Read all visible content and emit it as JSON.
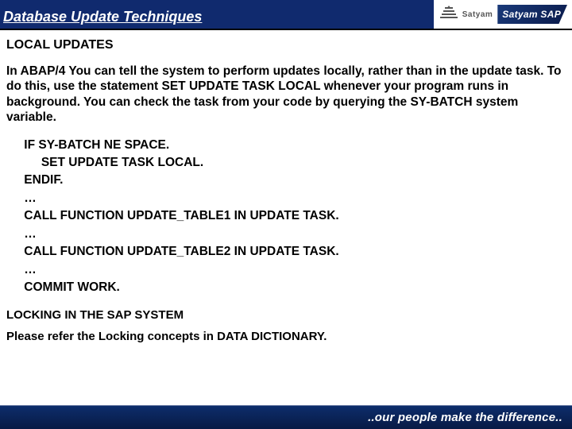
{
  "slide": {
    "title": "Database Update Techniques",
    "logos": {
      "satyam_text": "Satyam",
      "sap_text": "Satyam SAP"
    },
    "section1_heading": "LOCAL UPDATES",
    "paragraph1": "In ABAP/4 You can tell the system to perform updates locally, rather than in the update task. To do this, use the statement  SET UPDATE TASK LOCAL whenever your program runs in background. You can check the task from your code by querying the SY-BATCH system variable.",
    "code": " IF SY-BATCH NE SPACE.\n      SET UPDATE TASK LOCAL.\n ENDIF.\n …\n CALL FUNCTION UPDATE_TABLE1 IN UPDATE TASK.\n …\n CALL FUNCTION UPDATE_TABLE2 IN UPDATE TASK.\n …\n COMMIT WORK.",
    "section2_heading": "LOCKING IN THE SAP SYSTEM",
    "refer_text": "Please refer the Locking concepts in DATA DICTIONARY.",
    "footer": "..our people make the difference.."
  }
}
